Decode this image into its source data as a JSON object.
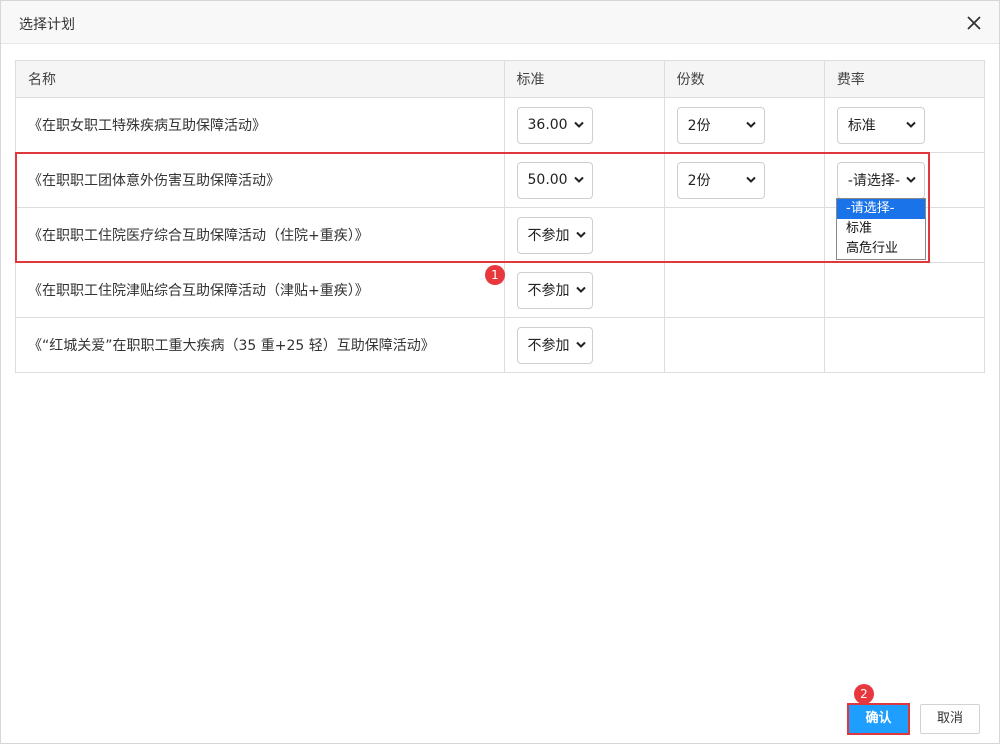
{
  "dialog": {
    "title": "选择计划",
    "close_icon": "close-icon"
  },
  "table": {
    "headers": [
      "名称",
      "标准",
      "份数",
      "费率"
    ],
    "rows": [
      {
        "name": "《在职女职工特殊疾病互助保障活动》",
        "standard": "36.00",
        "quantity": "2份",
        "rate": "标准"
      },
      {
        "name": "《在职职工团体意外伤害互助保障活动》",
        "standard": "50.00",
        "quantity": "2份",
        "rate": "-请选择-"
      },
      {
        "name": "《在职职工住院医疗综合互助保障活动（住院+重疾）》",
        "standard": "不参加"
      },
      {
        "name": "《在职职工住院津贴综合互助保障活动（津贴+重疾）》",
        "standard": "不参加"
      },
      {
        "name": "《“红城关爱”在职职工重大疾病（35 重+25 轻）互助保障活动》",
        "standard": "不参加"
      }
    ]
  },
  "rate_dropdown": {
    "options": [
      "-请选择-",
      "标准",
      "高危行业"
    ],
    "highlighted_index": 0
  },
  "annotations": {
    "badge_1": "1",
    "badge_2": "2",
    "highlight_color": "#e0373d"
  },
  "footer": {
    "confirm_label": "确认",
    "cancel_label": "取消"
  },
  "colors": {
    "primary": "#1e9fff",
    "dropdown_highlight": "#1a73e8",
    "badge": "#e8373d"
  }
}
